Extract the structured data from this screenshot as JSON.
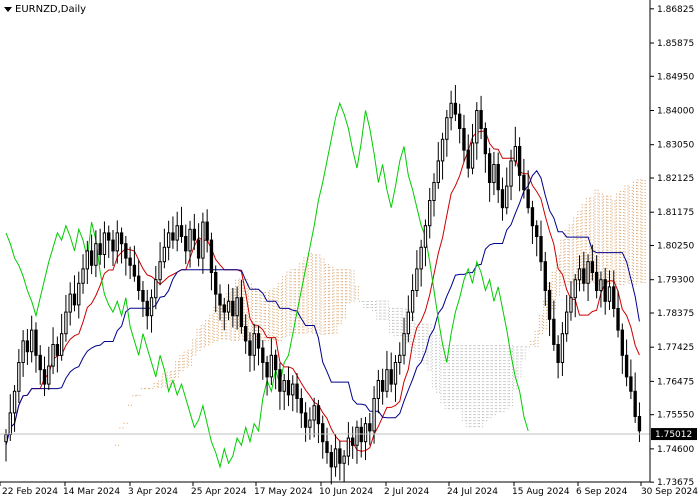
{
  "header": {
    "symbol_label": "EURNZD,Daily",
    "menu_icon": "triangle-down-icon"
  },
  "chart_data": {
    "type": "candlestick",
    "title": "",
    "instrument": "EURNZD",
    "timeframe": "Daily",
    "y_ticks": [
      "1.86825",
      "1.85875",
      "1.84950",
      "1.84000",
      "1.83050",
      "1.82125",
      "1.81175",
      "1.80250",
      "1.79300",
      "1.78375",
      "1.77425",
      "1.76475",
      "1.75550",
      "1.74600",
      "1.73675"
    ],
    "y_range": [
      1.7368,
      1.8707
    ],
    "x_ticks": [
      "22 Feb 2024",
      "14 Mar 2024",
      "3 Apr 2024",
      "25 Apr 2024",
      "17 May 2024",
      "10 Jun 2024",
      "2 Jul 2024",
      "24 Jul 2024",
      "15 Aug 2024",
      "6 Sep 2024",
      "30 Sep 2024"
    ],
    "current_price": "1.75012",
    "colors": {
      "tenkan": "#cc0000",
      "kijun": "#00008b",
      "chikou": "#00cc00",
      "cloud_bull": "#d9a066",
      "cloud_bear": "#bbbbbb",
      "candle": "#000000",
      "price_line": "#c0c0c0"
    },
    "close": [
      1.75,
      1.756,
      1.762,
      1.77,
      1.776,
      1.773,
      1.779,
      1.772,
      1.768,
      1.764,
      1.769,
      1.775,
      1.772,
      1.778,
      1.784,
      1.789,
      1.786,
      1.792,
      1.796,
      1.801,
      1.797,
      1.803,
      1.8,
      1.806,
      1.804,
      1.801,
      1.806,
      1.803,
      1.799,
      1.797,
      1.794,
      1.79,
      1.787,
      1.783,
      1.788,
      1.793,
      1.798,
      1.802,
      1.806,
      1.804,
      1.808,
      1.805,
      1.801,
      1.807,
      1.804,
      1.799,
      1.809,
      1.804,
      1.795,
      1.789,
      1.786,
      1.784,
      1.787,
      1.783,
      1.788,
      1.78,
      1.776,
      1.772,
      1.778,
      1.774,
      1.77,
      1.766,
      1.772,
      1.768,
      1.762,
      1.765,
      1.761,
      1.764,
      1.76,
      1.756,
      1.752,
      1.754,
      1.758,
      1.753,
      1.748,
      1.745,
      1.741,
      1.746,
      1.742,
      1.744,
      1.749,
      1.747,
      1.752,
      1.748,
      1.753,
      1.751,
      1.76,
      1.765,
      1.762,
      1.768,
      1.764,
      1.77,
      1.772,
      1.778,
      1.784,
      1.79,
      1.796,
      1.802,
      1.808,
      1.815,
      1.82,
      1.826,
      1.832,
      1.838,
      1.842,
      1.839,
      1.835,
      1.829,
      1.824,
      1.831,
      1.84,
      1.835,
      1.828,
      1.82,
      1.825,
      1.818,
      1.813,
      1.819,
      1.826,
      1.83,
      1.822,
      1.818,
      1.813,
      1.808,
      1.805,
      1.798,
      1.79,
      1.782,
      1.775,
      1.77,
      1.778,
      1.784,
      1.788,
      1.793,
      1.796,
      1.792,
      1.798,
      1.795,
      1.79,
      1.793,
      1.787,
      1.791,
      1.785,
      1.779,
      1.772,
      1.766,
      1.762,
      1.755,
      1.751
    ]
  }
}
